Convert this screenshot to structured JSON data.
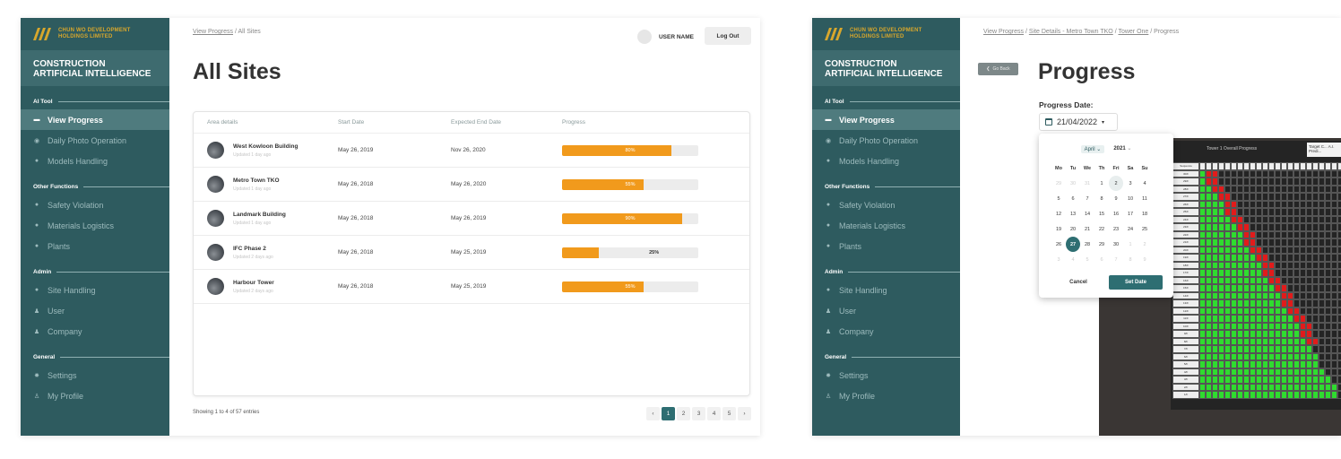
{
  "company": {
    "name_line1": "CHUN WO DEVELOPMENT",
    "name_line2": "HOLDINGS LIMITED"
  },
  "app_title": "CONSTRUCTION ARTIFICIAL INTELLIGENCE",
  "sidebar": {
    "sections": [
      {
        "title": "AI Tool",
        "items": [
          {
            "label": "View Progress",
            "icon": "monitor-icon",
            "active": true
          },
          {
            "label": "Daily Photo Operation",
            "icon": "camera-icon"
          },
          {
            "label": "Models Handling",
            "icon": "pin-icon"
          }
        ]
      },
      {
        "title": "Other Functions",
        "items": [
          {
            "label": "Safety Violation",
            "icon": "pin-icon"
          },
          {
            "label": "Materials Logistics",
            "icon": "pin-icon"
          },
          {
            "label": "Plants",
            "icon": "pin-icon"
          }
        ]
      },
      {
        "title": "Admin",
        "items": [
          {
            "label": "Site Handling",
            "icon": "pin-icon"
          },
          {
            "label": "User",
            "icon": "user-icon"
          },
          {
            "label": "Company",
            "icon": "user-icon"
          }
        ]
      },
      {
        "title": "General",
        "items": [
          {
            "label": "Settings",
            "icon": "gear-icon"
          },
          {
            "label": "My Profile",
            "icon": "profile-icon"
          }
        ]
      }
    ]
  },
  "screen1": {
    "breadcrumb": {
      "link": "View Progress",
      "sep": " / ",
      "current": "All Sites"
    },
    "user_name": "USER NAME",
    "logout_label": "Log Out",
    "title": "All Sites",
    "columns": [
      "Area details",
      "Start Date",
      "Expected End Date",
      "Progress"
    ],
    "rows": [
      {
        "name": "West Kowloon Building",
        "updated": "Updated 1 day ago",
        "start": "May 26, 2019",
        "end": "Nov 26, 2020",
        "progress": 80,
        "label": "80%"
      },
      {
        "name": "Metro Town TKO",
        "updated": "Updated 1 day ago",
        "start": "May 26, 2018",
        "end": "May 26, 2020",
        "progress": 60,
        "label": "55%"
      },
      {
        "name": "Landmark Building",
        "updated": "Updated 1 day ago",
        "start": "May 26, 2018",
        "end": "May 26, 2019",
        "progress": 88,
        "label": "90%"
      },
      {
        "name": "IFC Phase 2",
        "updated": "Updated 2 days ago",
        "start": "May 26, 2018",
        "end": "May 25, 2019",
        "progress": 27,
        "label": "25%"
      },
      {
        "name": "Harbour Tower",
        "updated": "Updated 2 days ago",
        "start": "May 26, 2018",
        "end": "May 25, 2019",
        "progress": 60,
        "label": "55%"
      }
    ],
    "showing": "Showing 1 to 4 of 57 entries",
    "pages": [
      "‹",
      "1",
      "2",
      "3",
      "4",
      "5",
      "›"
    ],
    "current_page": "1"
  },
  "screen2": {
    "breadcrumb": [
      "View Progress",
      "Site Details - Metro Town TKO",
      "Tower One",
      "Progress"
    ],
    "go_back": "Go Back",
    "title": "Progress",
    "date_label": "Progress Date:",
    "date_value": "21/04/2022",
    "calendar": {
      "month": "April",
      "year": "2021",
      "weekdays": [
        "Mo",
        "Tu",
        "We",
        "Th",
        "Fri",
        "Sa",
        "Su"
      ],
      "days": [
        "29",
        "30",
        "31",
        "1",
        "2",
        "3",
        "4",
        "5",
        "6",
        "7",
        "8",
        "9",
        "10",
        "11",
        "12",
        "13",
        "14",
        "15",
        "16",
        "17",
        "18",
        "19",
        "20",
        "21",
        "22",
        "23",
        "24",
        "25",
        "26",
        "27",
        "28",
        "29",
        "30",
        "1",
        "2",
        "3",
        "4",
        "5",
        "6",
        "7",
        "8",
        "9"
      ],
      "selected": "27",
      "cancel": "Cancel",
      "set": "Set Date"
    },
    "chart_title": "Tower 1 Overall Progress",
    "chart_target": "Target C... A.I. Predi...",
    "floors": [
      "Sequence",
      "30/F",
      "29/F",
      "28/F",
      "27/F",
      "26/F",
      "25/F",
      "24/F",
      "23/F",
      "22/F",
      "21/F",
      "20/F",
      "19/F",
      "18/F",
      "17/F",
      "16/F",
      "15/F",
      "14/F",
      "13/F",
      "12/F",
      "11/F",
      "10/F",
      "9/F",
      "8/F",
      "7/F",
      "6/F",
      "5/F",
      "4/F",
      "3/F",
      "2/F",
      "1/F"
    ]
  }
}
